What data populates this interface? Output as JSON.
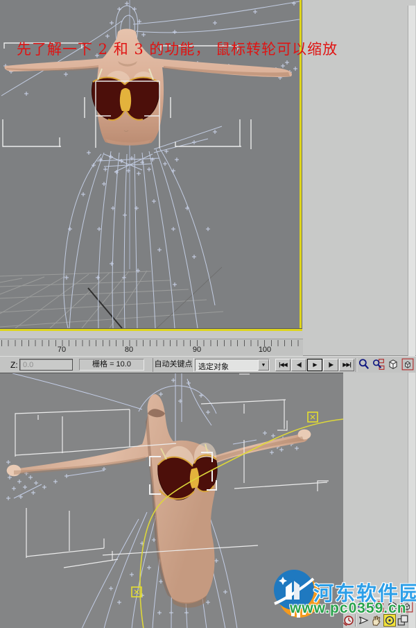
{
  "annotation": {
    "text": "先了解一下 2 和 3 的功能， 鼠标转轮可以缩放"
  },
  "timeline": {
    "tick_labels": [
      "70",
      "80",
      "90",
      "100"
    ]
  },
  "statusbar": {
    "z_label": "Z:",
    "z_value": "0.0",
    "grid_readout": "栅格 = 10.0",
    "autokey_label": "自动关键点",
    "selection_filter": "选定对象",
    "dropdown_arrow": "▼",
    "playback": {
      "go_to_start": "|◀◀",
      "previous_frame": "◀|",
      "play": "▶",
      "next_frame": "|▶",
      "go_to_end": "▶▶|"
    }
  },
  "nav_controls": {
    "icons": [
      "zoom",
      "zoom-all",
      "zoom-extents",
      "zoom-extents-all",
      "time-configuration",
      "field-of-view",
      "pan",
      "arc-rotate",
      "min-max-toggle"
    ],
    "active_tool_top_cluster": "pan",
    "active_tool_bottom_cluster": "arc-rotate",
    "highlight_color": "#f2e23c"
  },
  "watermark": {
    "site_name": "河东软件园",
    "site_url": "www.pc0359.cn",
    "name_color": "#2d9fe8",
    "url_color": "#28a24b"
  },
  "colors": {
    "viewport_bg": "#7e8082",
    "panel_bg": "#c8c9c8",
    "active_viewport_border": "#ded51d",
    "wireframe_blue": "#c2cce2",
    "selection_white": "#ececec",
    "trajectory_yellow": "#ddd73a",
    "annotation_red": "#e01312",
    "bra_maroon": "#4c0f0a",
    "bra_trim_gold": "#d8a438"
  }
}
